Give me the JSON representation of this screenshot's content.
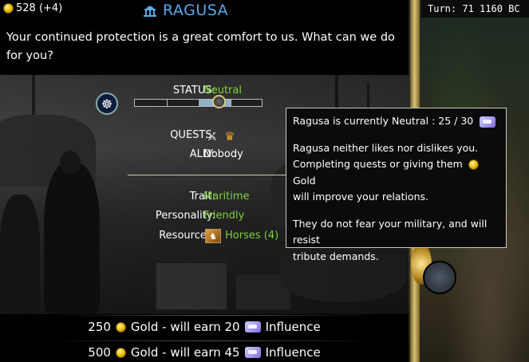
{
  "header": {
    "gold": "528 (+4)",
    "city_name": "RAGUSA"
  },
  "turn_info": "Turn: 71   1160 BC",
  "greeting": "Your continued protection is a great comfort to us.  What can we do for you?",
  "status": {
    "label": "STATUS:",
    "value": "Neutral",
    "influence_current": 25,
    "influence_max": 30
  },
  "quests": {
    "label": "QUESTS:",
    "icons": [
      "crossed-swords-icon",
      "crown-icon"
    ]
  },
  "ally": {
    "label": "ALLY:",
    "value": "Nobody"
  },
  "trait": {
    "label": "Trait:",
    "value": "Maritime"
  },
  "personality": {
    "label": "Personality:",
    "value": "Friendly"
  },
  "resources": {
    "label": "Resources:",
    "value": "Horses (4)",
    "icon": "horses-icon"
  },
  "tooltip": {
    "line1": "Ragusa is currently Neutral : 25 / 30",
    "line2": "Ragusa neither likes nor dislikes you.",
    "line3_pre": "Completing quests or giving them",
    "line3_post": "Gold",
    "line4": "will improve your relations.",
    "line5": "They do not fear your military, and will resist",
    "line6": "tribute demands."
  },
  "gifts": [
    {
      "amount": "250",
      "gold_label": "Gold - will earn 20",
      "influence_label": "Influence"
    },
    {
      "amount": "500",
      "gold_label": "Gold - will earn 45",
      "influence_label": "Influence"
    }
  ],
  "colors": {
    "title": "#5aa9e6",
    "value_green": "#7fd13b",
    "panel_bg": "#000000"
  }
}
